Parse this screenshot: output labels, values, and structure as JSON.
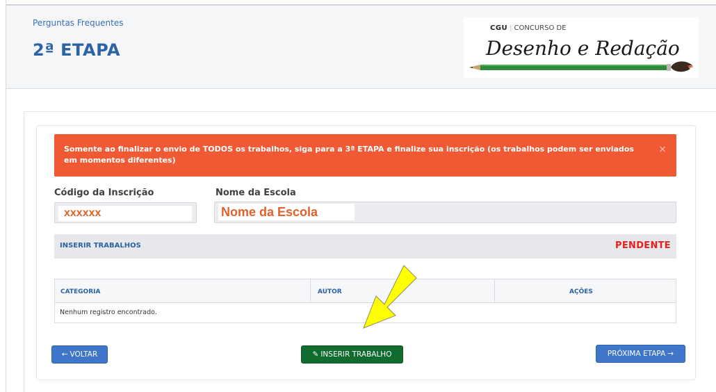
{
  "header": {
    "breadcrumb": "Perguntas Frequentes",
    "title": "2ª ETAPA",
    "logo": {
      "org": "CGU",
      "line": "CONCURSO DE",
      "script": "Desenho e Redação"
    }
  },
  "alert": {
    "message": "Somente ao finalizar o envio de TODOS os trabalhos, siga para a 3ª ETAPA e finalize sua inscrição (os trabalhos podem ser enviados em momentos diferentes)",
    "close_icon": "×"
  },
  "form": {
    "codigo_label": "Código da Inscrição",
    "codigo_value": "xxxxxx",
    "escola_label": "Nome da Escola",
    "escola_value": "Nome da Escola"
  },
  "section": {
    "title": "INSERIR TRABALHOS",
    "status": "PENDENTE"
  },
  "table": {
    "columns": [
      "CATEGORIA",
      "AUTOR",
      "AÇÕES"
    ],
    "empty_message": "Nenhum registro encontrado."
  },
  "buttons": {
    "back": "VOLTAR",
    "back_icon": "←",
    "insert": "INSERIR TRABALHO",
    "insert_icon": "✎",
    "next": "PRÓXIMA ETAPA",
    "next_icon": "→"
  },
  "colors": {
    "primary": "#2b63a6",
    "alert": "#ef5a35",
    "danger": "#e8201a",
    "success": "#116b2e",
    "button_blue": "#3f76c9",
    "highlight_arrow": "#ffff00"
  }
}
